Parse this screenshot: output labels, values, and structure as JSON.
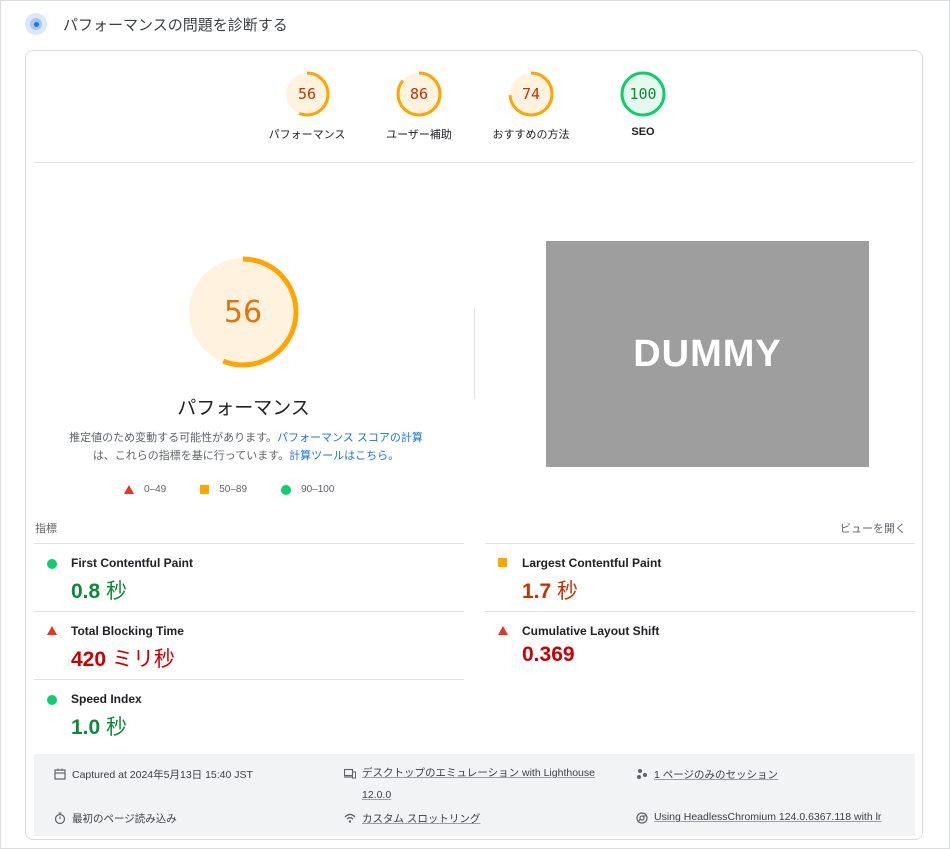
{
  "header": {
    "title": "パフォーマンスの問題を診断する"
  },
  "categories": [
    {
      "score": "56",
      "label": "パフォーマンス",
      "status": "average"
    },
    {
      "score": "86",
      "label": "ユーザー補助",
      "status": "average"
    },
    {
      "score": "74",
      "label": "おすすめの方法",
      "status": "average"
    },
    {
      "score": "100",
      "label": "SEO",
      "status": "pass"
    }
  ],
  "performance": {
    "score": "56",
    "label": "パフォーマンス",
    "desc_text1": "推定値のため変動する可能性があります。",
    "desc_link1": "パフォーマンス スコアの計算",
    "desc_text2": "は、これらの指標を基に行っています。",
    "desc_link2": "計算ツールはこちら。"
  },
  "legend": {
    "fail": "0–49",
    "average": "50–89",
    "pass": "90–100"
  },
  "screenshot_placeholder": "DUMMY",
  "metrics_header": {
    "title": "指標",
    "expand": "ビューを開く"
  },
  "metrics": [
    {
      "name": "First Contentful Paint",
      "value": "0.8",
      "unit": "秒",
      "status": "pass"
    },
    {
      "name": "Largest Contentful Paint",
      "value": "1.7",
      "unit": "秒",
      "status": "average"
    },
    {
      "name": "Total Blocking Time",
      "value": "420",
      "unit": "ミリ秒",
      "status": "fail"
    },
    {
      "name": "Cumulative Layout Shift",
      "value": "0.369",
      "unit": "",
      "status": "fail"
    },
    {
      "name": "Speed Index",
      "value": "1.0",
      "unit": "秒",
      "status": "pass"
    }
  ],
  "footer": {
    "captured": "Captured at 2024年5月13日 15:40 JST",
    "emulation_a": "デスクトップのエミュレーション with Lighthouse",
    "emulation_b": "12.0.0",
    "session": "1 ページのみのセッション",
    "load": "最初のページ読み込み",
    "throttling": "カスタム スロットリング",
    "browser": "Using HeadlessChromium 124.0.6367.118 with lr"
  },
  "colors": {
    "pass": "#0cce6b",
    "average": "#ffa400",
    "fail": "#eb3323",
    "link": "#1a73e8"
  }
}
